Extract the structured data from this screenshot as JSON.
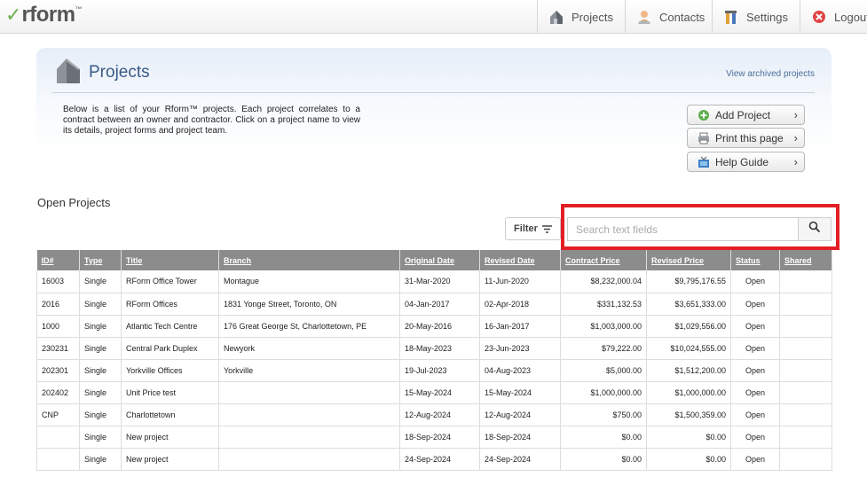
{
  "app": {
    "logo_text": "rform",
    "logo_tm": "™",
    "logo_check": "✓"
  },
  "nav": [
    {
      "label": "Projects",
      "icon": "house-icon"
    },
    {
      "label": "Contacts",
      "icon": "contact-icon"
    },
    {
      "label": "Settings",
      "icon": "tools-icon"
    },
    {
      "label": "Logout",
      "icon": "logout-icon"
    }
  ],
  "panel": {
    "title": "Projects",
    "archived_link": "View archived projects",
    "description": "Below is a list of your Rform™ projects. Each project correlates to a contract between an owner and contractor. Click on a project name to view its details, project forms and project team.",
    "buttons": {
      "add": "Add Project",
      "print": "Print this page",
      "help": "Help Guide"
    }
  },
  "open_projects_heading": "Open Projects",
  "filter_label": "Filter",
  "search": {
    "placeholder": "Search text fields"
  },
  "table": {
    "headers": [
      "ID#",
      "Type",
      "Title",
      "Branch",
      "Original Date",
      "Revised Date",
      "Contract Price",
      "Revised Price",
      "Status",
      "Shared"
    ],
    "rows": [
      [
        "16003",
        "Single",
        "RForm Office Tower",
        "Montague",
        "31-Mar-2020",
        "11-Jun-2020",
        "$8,232,000.04",
        "$9,795,176.55",
        "Open",
        ""
      ],
      [
        "2016",
        "Single",
        "RForm Offices",
        "1831 Yonge Street, Toronto, ON",
        "04-Jan-2017",
        "02-Apr-2018",
        "$331,132.53",
        "$3,651,333.00",
        "Open",
        ""
      ],
      [
        "1000",
        "Single",
        "Atlantic Tech Centre",
        "176 Great George St, Charlottetown, PE",
        "20-May-2016",
        "16-Jan-2017",
        "$1,003,000.00",
        "$1,029,556.00",
        "Open",
        ""
      ],
      [
        "230231",
        "Single",
        "Central Park Duplex",
        "Newyork",
        "18-May-2023",
        "23-Jun-2023",
        "$79,222.00",
        "$10,024,555.00",
        "Open",
        ""
      ],
      [
        "202301",
        "Single",
        "Yorkville Offices",
        "Yorkville",
        "19-Jul-2023",
        "04-Aug-2023",
        "$5,000.00",
        "$1,512,200.00",
        "Open",
        ""
      ],
      [
        "202402",
        "Single",
        "Unit Price test",
        "",
        "15-May-2024",
        "15-May-2024",
        "$1,000,000.00",
        "$1,000,000.00",
        "Open",
        ""
      ],
      [
        "CNP",
        "Single",
        "Charlottetown",
        "",
        "12-Aug-2024",
        "12-Aug-2024",
        "$750.00",
        "$1,500,359.00",
        "Open",
        ""
      ],
      [
        "",
        "Single",
        "New project",
        "",
        "18-Sep-2024",
        "18-Sep-2024",
        "$0.00",
        "$0.00",
        "Open",
        ""
      ],
      [
        "",
        "Single",
        "New project",
        "",
        "24-Sep-2024",
        "24-Sep-2024",
        "$0.00",
        "$0.00",
        "Open",
        ""
      ]
    ]
  },
  "colors": {
    "highlight": "#e31e24",
    "header_bg": "#8c8c8c",
    "title": "#3a5a86"
  }
}
